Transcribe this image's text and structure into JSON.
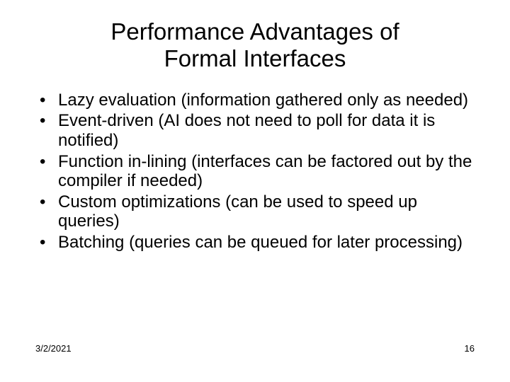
{
  "title_line1": "Performance Advantages of",
  "title_line2": "Formal Interfaces",
  "bullets": [
    "Lazy evaluation (information gathered only as needed)",
    "Event-driven (AI does not need to poll for data it is notified)",
    "Function in-lining (interfaces can be factored out by the compiler if needed)",
    "Custom optimizations (can be used to speed up queries)",
    "Batching (queries can be queued for later processing)"
  ],
  "footer": {
    "date": "3/2/2021",
    "page": "16"
  }
}
